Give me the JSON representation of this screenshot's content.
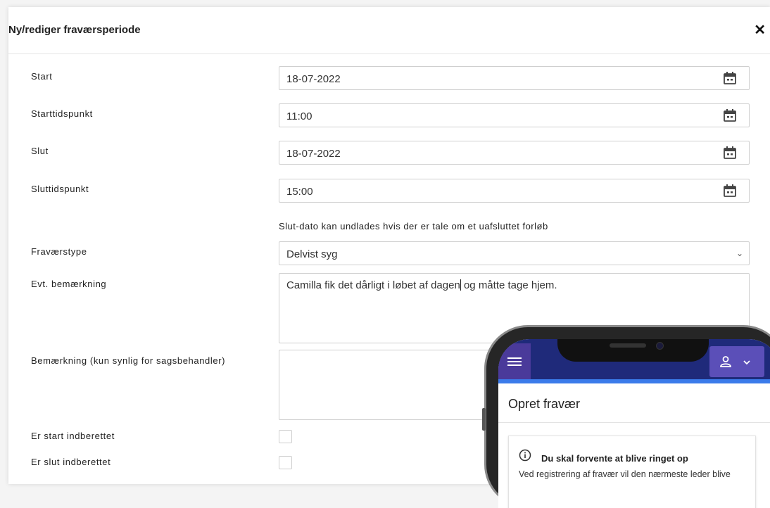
{
  "dialog": {
    "title": "Ny/rediger fraværsperiode",
    "close_icon": "close-icon"
  },
  "form": {
    "start_label": "Start",
    "start_value": "18-07-2022",
    "starttid_label": "Starttidspunkt",
    "starttid_value": "11:00",
    "slut_label": "Slut",
    "slut_value": "18-07-2022",
    "sluttid_label": "Sluttidspunkt",
    "sluttid_value": "15:00",
    "hint": "Slut-dato kan undlades hvis der er tale om et uafsluttet forløb",
    "type_label": "Fraværstype",
    "type_value": "Delvist syg",
    "remark_label": "Evt. bemærkning",
    "remark_before_caret": "Camilla fik det dårligt i løbet af dagen",
    "remark_after_caret": " og måtte tage hjem.",
    "admin_remark_label": "Bemærkning (kun synlig for sagsbehandler)",
    "admin_remark_value": "",
    "start_reported_label": "Er start indberettet",
    "end_reported_label": "Er slut indberettet",
    "start_reported_checked": false,
    "end_reported_checked": false,
    "icons": [
      "calendar-icon",
      "chevron-down-icon"
    ]
  },
  "phone": {
    "title": "Opret fravær",
    "card_title": "Du skal forvente at blive ringet op",
    "card_text": "Ved registrering af fravær vil den nærmeste leder blive",
    "icons": [
      "menu-icon",
      "user-icon",
      "chevron-down-icon",
      "info-icon"
    ],
    "colors": {
      "topbar": "#1f2a7a",
      "accent": "#3b7bea",
      "button": "#5b4fb8"
    }
  }
}
